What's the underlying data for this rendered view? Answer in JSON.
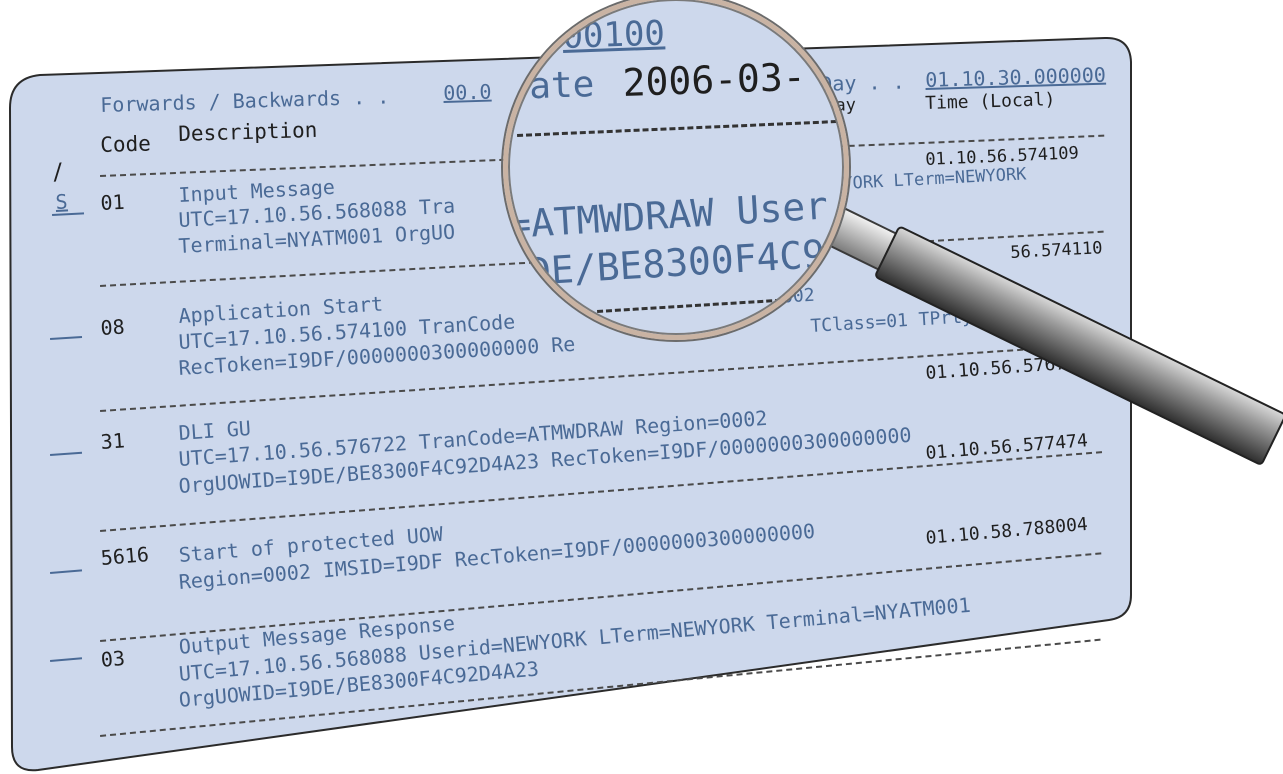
{
  "header": {
    "forwards_backwards_label": "Forwards / Backwards . .",
    "forwards_backwards_value": "00.0",
    "day_label": "Day . .",
    "time_value": "01.10.30.000000",
    "day_col": "day",
    "time_local": "Time (Local)",
    "code_col": "Code",
    "description_col": "Description",
    "slash": "/"
  },
  "lens": {
    "top_value": "00100",
    "date_label": "Date",
    "date_value": "2006-03-",
    "line1": "=ATMWDRAW User",
    "line2": "DE/BE8300F4C9"
  },
  "records": [
    {
      "cmd": "S",
      "code": "01",
      "title": "Input Message",
      "time": "01.10.56.574109",
      "lines": [
        "UTC=17.10.56.568088 Tra",
        "Terminal=NYATM001 OrgUO"
      ],
      "right_text": "YORK LTerm=NEWYORK"
    },
    {
      "cmd": "",
      "code": "08",
      "title": "Application Start",
      "time": "56.574110",
      "lines": [
        "UTC=17.10.56.574100 TranCode",
        "RecToken=I9DF/0000000300000000 Re"
      ],
      "right_text": "=0002",
      "right_text2": "TClass=01 TPrty=0"
    },
    {
      "cmd": "",
      "code": "31",
      "title": "DLI GU",
      "time": "01.10.56.57672",
      "lines": [
        "UTC=17.10.56.576722 TranCode=ATMWDRAW Region=0002",
        "OrgUOWID=I9DE/BE8300F4C92D4A23 RecToken=I9DF/0000000300000000"
      ]
    },
    {
      "cmd": "",
      "code": "5616",
      "title": "Start of protected UOW",
      "time": "01.10.56.577474",
      "lines": [
        "Region=0002 IMSID=I9DF RecToken=I9DF/0000000300000000"
      ]
    },
    {
      "cmd": "",
      "code": "03",
      "title": "Output Message Response",
      "time": "01.10.58.788004",
      "lines": [
        "UTC=17.10.56.568088 Userid=NEWYORK LTerm=NEWYORK Terminal=NYATM001",
        "OrgUOWID=I9DE/BE8300F4C92D4A23"
      ]
    }
  ],
  "colors": {
    "panel": "#cdd8ec",
    "text_blue": "#4a6a96",
    "text_dark": "#1f1f1f",
    "handle_dark": "#3c3c3c",
    "rim": "#c9b3a3"
  }
}
